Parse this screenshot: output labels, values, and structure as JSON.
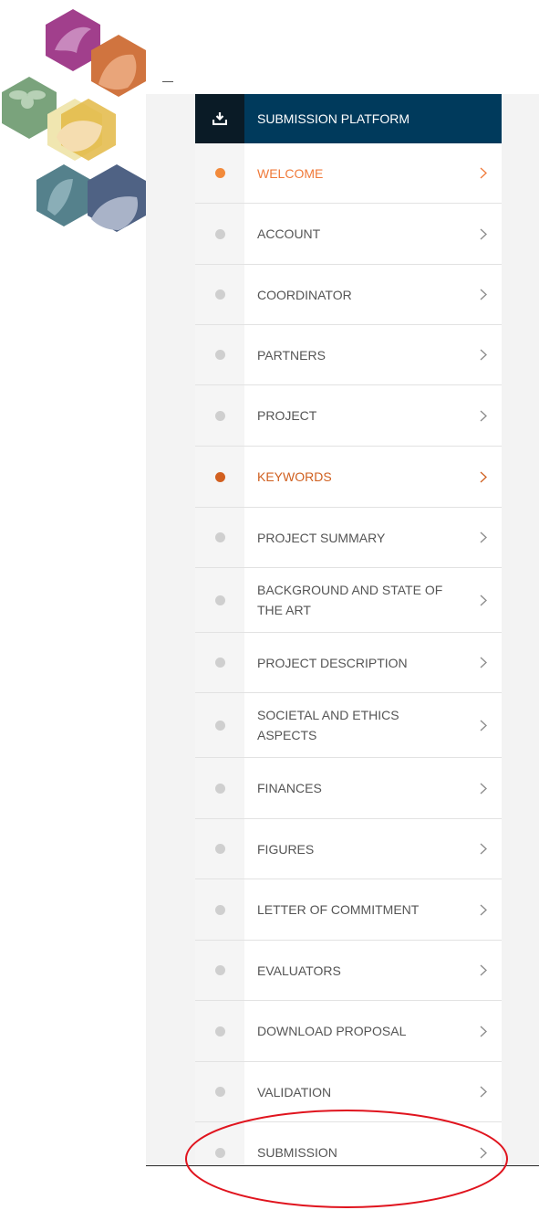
{
  "header": {
    "title": "SUBMISSION PLATFORM",
    "icon": "download-tray-icon"
  },
  "menu": {
    "items": [
      {
        "label": "WELCOME",
        "state": "active"
      },
      {
        "label": "ACCOUNT",
        "state": "default"
      },
      {
        "label": "COORDINATOR",
        "state": "default"
      },
      {
        "label": "PARTNERS",
        "state": "default"
      },
      {
        "label": "PROJECT",
        "state": "default"
      },
      {
        "label": "KEYWORDS",
        "state": "strong"
      },
      {
        "label": "PROJECT SUMMARY",
        "state": "default"
      },
      {
        "label": "BACKGROUND AND STATE OF THE ART",
        "state": "default"
      },
      {
        "label": "PROJECT DESCRIPTION",
        "state": "default"
      },
      {
        "label": "SOCIETAL AND ETHICS ASPECTS",
        "state": "default"
      },
      {
        "label": "FINANCES",
        "state": "default"
      },
      {
        "label": "FIGURES",
        "state": "default"
      },
      {
        "label": "LETTER OF COMMITMENT",
        "state": "default"
      },
      {
        "label": "EVALUATORS",
        "state": "default"
      },
      {
        "label": "DOWNLOAD PROPOSAL",
        "state": "default"
      },
      {
        "label": "VALIDATION",
        "state": "default"
      },
      {
        "label": "SUBMISSION",
        "state": "default"
      }
    ]
  },
  "colors": {
    "header_bg": "#003a5c",
    "header_icon_bg": "#0a1b26",
    "active": "#f07a3a",
    "strong": "#d06020",
    "annotation": "#e0141e"
  }
}
